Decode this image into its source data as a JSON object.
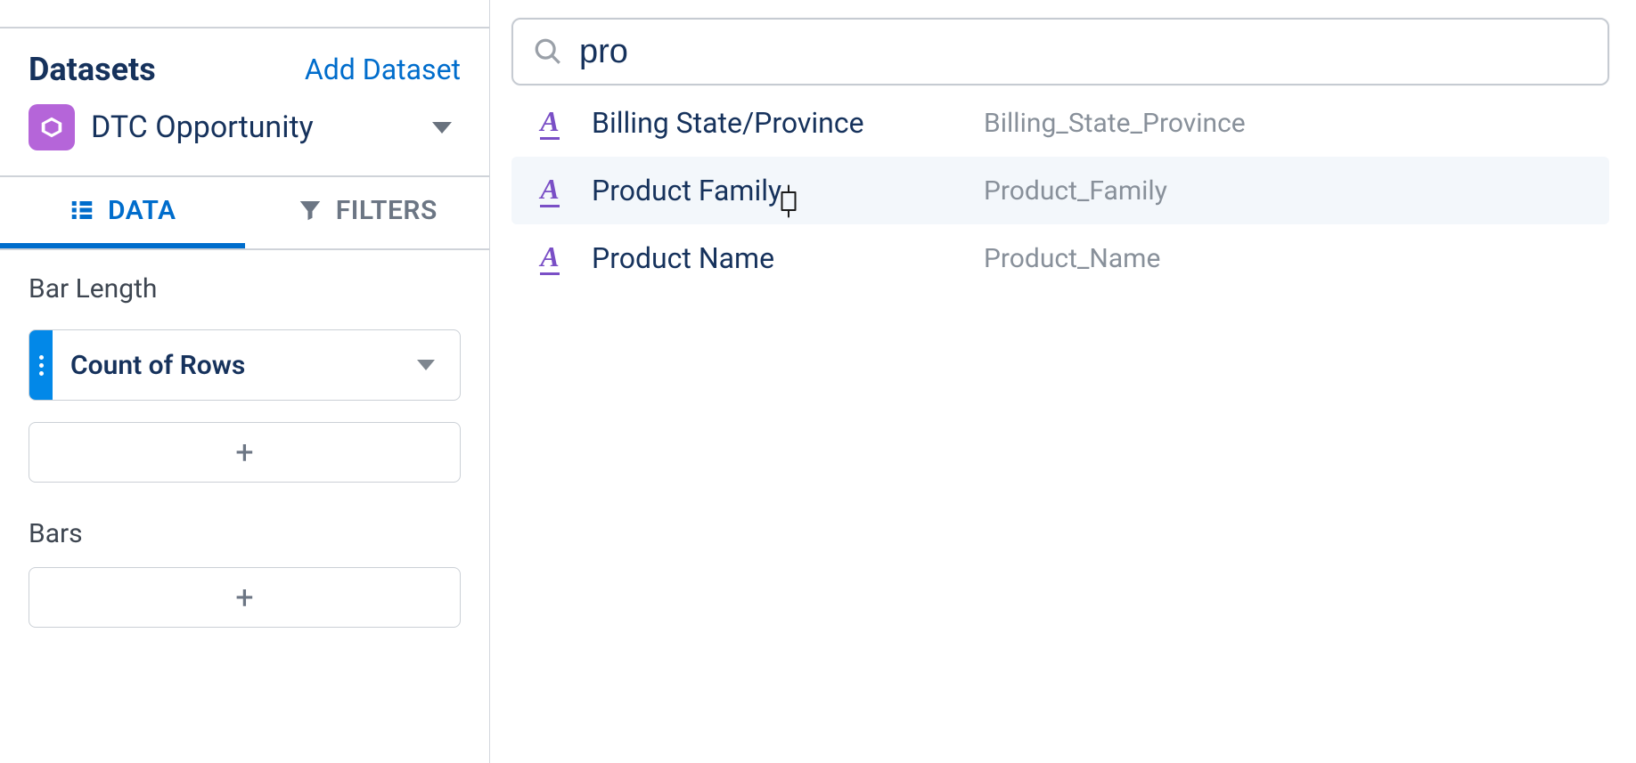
{
  "sidebar": {
    "title": "Datasets",
    "add_label": "Add Dataset",
    "dataset_name": "DTC Opportunity"
  },
  "tabs": {
    "data": "DATA",
    "filters": "FILTERS"
  },
  "bar_length": {
    "label": "Bar Length",
    "value": "Count of Rows"
  },
  "bars": {
    "label": "Bars"
  },
  "search": {
    "value": "pro"
  },
  "results": [
    {
      "label": "Billing State/Province",
      "api": "Billing_State_Province",
      "hovered": false
    },
    {
      "label": "Product Family",
      "api": "Product_Family",
      "hovered": true
    },
    {
      "label": "Product Name",
      "api": "Product_Name",
      "hovered": false
    }
  ],
  "icons": {
    "plus": "+",
    "text_glyph": "A"
  }
}
